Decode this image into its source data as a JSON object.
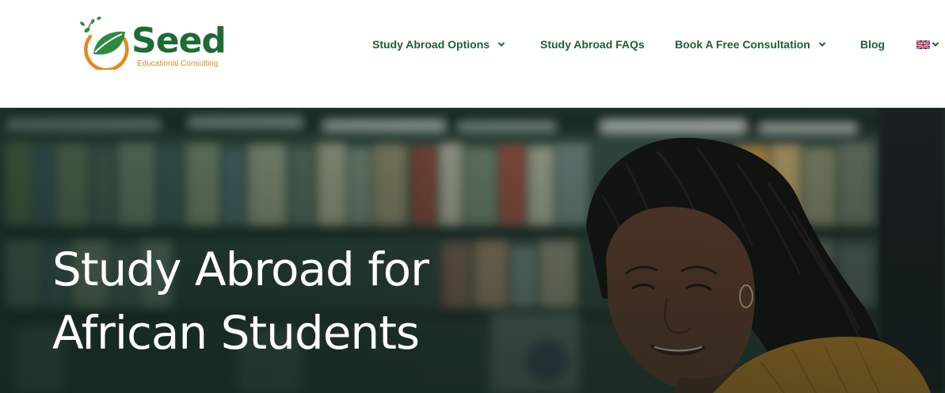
{
  "brand": {
    "name": "Seed",
    "tagline": "Educational Consulting",
    "primary_color": "#1f6b34",
    "accent_color": "#e08a1c"
  },
  "nav": {
    "items": [
      {
        "label": "Study Abroad Options",
        "has_dropdown": true
      },
      {
        "label": "Study Abroad FAQs",
        "has_dropdown": false
      },
      {
        "label": "Book A Free Consultation",
        "has_dropdown": true
      },
      {
        "label": "Blog",
        "has_dropdown": false
      }
    ],
    "language": {
      "icon": "uk-flag-icon",
      "has_dropdown": true
    }
  },
  "hero": {
    "title_line1": "Study Abroad for",
    "title_line2": "African Students",
    "background": "library-student-photo"
  }
}
